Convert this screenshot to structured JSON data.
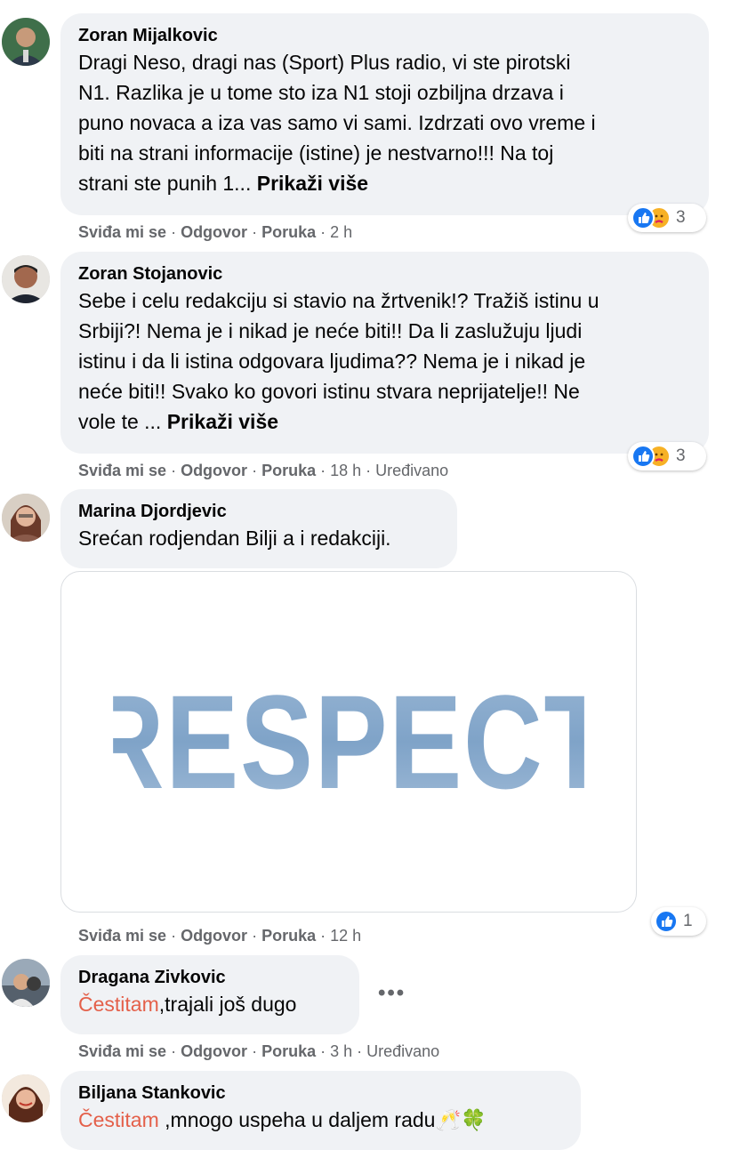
{
  "comments": [
    {
      "author": "Zoran Mijalkovic",
      "text": "Dragi Neso, dragi nas (Sport) Plus radio, vi ste pirotski\nN1. Razlika je u tome sto iza N1 stoji ozbiljna drzava i\npuno novaca a iza vas samo vi sami. Izdrzati ovo vreme i\nbiti na strani informacije (istine) je nestvarno!!! Na toj\nstrani ste punih 1... ",
      "more": "Prikaži više",
      "like": "Sviđa mi se",
      "reply": "Odgovor",
      "message": "Poruka",
      "time": "2 h",
      "reactions": "3"
    },
    {
      "author": "Zoran Stojanovic",
      "text": "Sebe i celu redakciju si stavio na žrtvenik!? Tražiš istinu u\nSrbiji?! Nema je i nikad je neće biti!! Da li zaslužuju ljudi\nistinu i da li istina odgovara ljudima?? Nema je i nikad je\nneće biti!! Svako ko govori istinu stvara neprijatelje!! Ne\nvole te ... ",
      "more": "Prikaži više",
      "like": "Sviđa mi se",
      "reply": "Odgovor",
      "message": "Poruka",
      "time": "18 h",
      "edited": "Uređivano",
      "reactions": "3"
    },
    {
      "author": "Marina Djordjevic",
      "text": "Srećan rodjendan Bilji a i redakciji.",
      "image_text": "RESPECT",
      "like": "Sviđa mi se",
      "reply": "Odgovor",
      "message": "Poruka",
      "time": "12 h",
      "reactions": "1"
    },
    {
      "author": "Dragana Zivkovic",
      "mention": "Čestitam",
      "text": ",trajali još dugo",
      "like": "Sviđa mi se",
      "reply": "Odgovor",
      "message": "Poruka",
      "time": "3 h",
      "edited": "Uređivano",
      "more_options": "•••"
    },
    {
      "author": "Biljana Stankovic",
      "mention": "Čestitam",
      "text": " ,mnogo uspeha u daljem radu🥂🍀"
    }
  ],
  "sep": "·",
  "colors": {
    "bubble": "#f0f2f5",
    "meta": "#65676b",
    "mention": "#e4604a",
    "like": "#1877f2"
  }
}
